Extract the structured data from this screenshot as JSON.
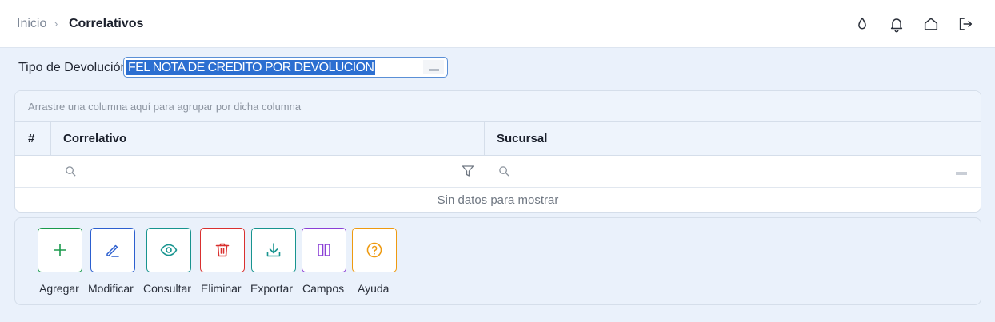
{
  "breadcrumb": {
    "home": "Inicio",
    "separator": "›",
    "current": "Correlativos"
  },
  "header_icons": [
    "drop-icon",
    "bell-icon",
    "home-icon",
    "logout-icon"
  ],
  "tipo": {
    "label": "Tipo de Devolución",
    "value": "FEL NOTA DE CREDITO POR DEVOLUCION"
  },
  "grid": {
    "group_hint": "Arrastre una columna aquí para agrupar por dicha columna",
    "columns": [
      "#",
      "Correlativo",
      "Sucursal"
    ],
    "empty_text": "Sin datos para mostrar"
  },
  "actions": [
    {
      "label": "Agregar",
      "icon": "plus-icon",
      "color": "#1a9a4c"
    },
    {
      "label": "Modificar",
      "icon": "pencil-icon",
      "color": "#2c5fcf"
    },
    {
      "label": "Consultar",
      "icon": "eye-icon",
      "color": "#17948f"
    },
    {
      "label": "Eliminar",
      "icon": "trash-icon",
      "color": "#d9302f"
    },
    {
      "label": "Exportar",
      "icon": "download-icon",
      "color": "#17948f"
    },
    {
      "label": "Campos",
      "icon": "columns-icon",
      "color": "#8a3fd6"
    },
    {
      "label": "Ayuda",
      "icon": "help-icon",
      "color": "#ee9a10"
    }
  ]
}
